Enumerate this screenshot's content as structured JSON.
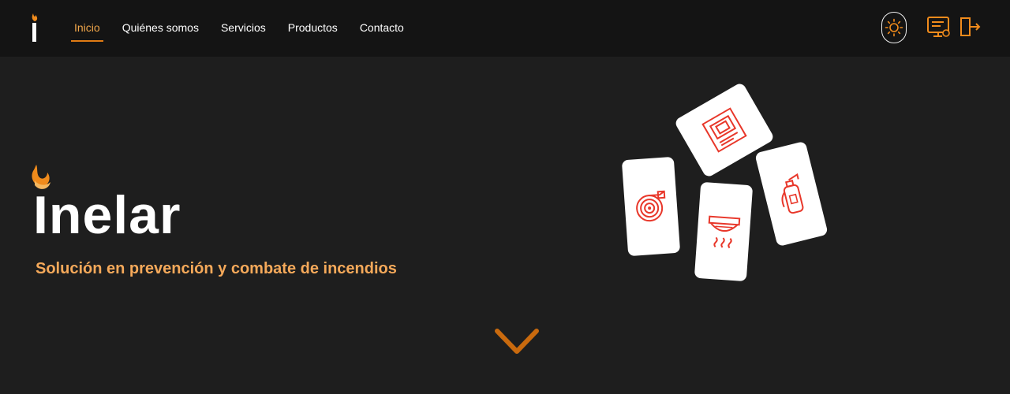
{
  "nav": {
    "items": [
      {
        "label": "Inicio",
        "active": true
      },
      {
        "label": "Quiénes somos",
        "active": false
      },
      {
        "label": "Servicios",
        "active": false
      },
      {
        "label": "Productos",
        "active": false
      },
      {
        "label": "Contacto",
        "active": false
      }
    ]
  },
  "header_actions": {
    "theme_icon": "sun-icon",
    "account_icon": "monitor-user-icon",
    "logout_icon": "logout-icon"
  },
  "hero": {
    "title": "nelar",
    "title_prefix": "I",
    "tagline": "Solución en prevención y combate de incendios",
    "cards": [
      "fire-hose-icon",
      "fire-alarm-panel-icon",
      "smoke-detector-icon",
      "fire-extinguisher-icon"
    ]
  },
  "colors": {
    "accent": "#e07b14",
    "accent_light": "#f5a95a",
    "card_icon": "#e8372a",
    "background": "#1e1e1e",
    "navbar": "#141414"
  }
}
